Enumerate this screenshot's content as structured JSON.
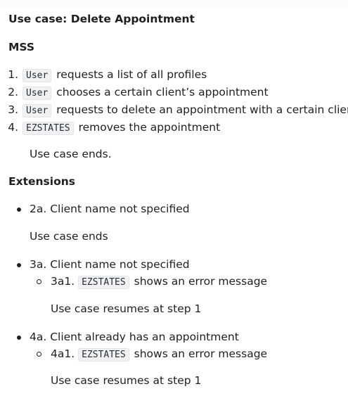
{
  "title": "Use case: Delete Appointment",
  "mss_heading": "MSS",
  "mss_steps": [
    {
      "num": "1.",
      "code": "User",
      "text": "requests a list of all profiles"
    },
    {
      "num": "2.",
      "code": "User",
      "text": "chooses a certain client’s appointment"
    },
    {
      "num": "3.",
      "code": "User",
      "text": "requests to delete an appointment with a certain client"
    },
    {
      "num": "4.",
      "code": "EZSTATES",
      "text": "removes the appointment"
    }
  ],
  "mss_end": "Use case ends.",
  "extensions_heading": "Extensions",
  "extensions": [
    {
      "text": "2a. Client name not specified",
      "note": "Use case ends"
    },
    {
      "text": "3a. Client name not specified",
      "sub": {
        "label": "3a1.",
        "code": "EZSTATES",
        "text": "shows an error message"
      },
      "note": "Use case resumes at step 1"
    },
    {
      "text": "4a. Client already has an appointment",
      "sub": {
        "label": "4a1.",
        "code": "EZSTATES",
        "text": "shows an error message"
      },
      "note": "Use case resumes at step 1"
    }
  ]
}
